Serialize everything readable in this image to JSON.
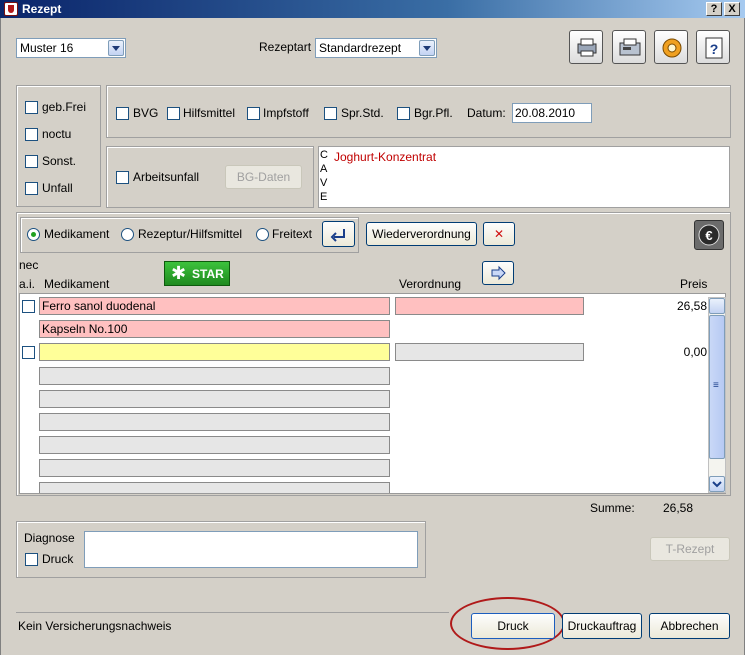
{
  "window": {
    "title": "Rezept",
    "help_btn": "?",
    "close_btn": "X"
  },
  "header": {
    "form_select": "Muster 16",
    "rezeptart_label": "Rezeptart",
    "rezeptart_select": "Standardrezept",
    "toolbar_icons": [
      "printer-icon",
      "card-reader-icon",
      "settings-icon",
      "help-book-icon"
    ]
  },
  "left_flags": [
    {
      "label": "geb.Frei",
      "checked": false
    },
    {
      "label": "noctu",
      "checked": false
    },
    {
      "label": "Sonst.",
      "checked": false
    },
    {
      "label": "Unfall",
      "checked": false
    }
  ],
  "top_flags": {
    "bvg": "BVG",
    "hilfsmittel": "Hilfsmittel",
    "impfstoff": "Impfstoff",
    "spr_std": "Spr.Std.",
    "bgr_pfl": "Bgr.Pfl.",
    "datum_label": "Datum:",
    "datum_value": "20.08.2010"
  },
  "arbeitsunfall": {
    "label": "Arbeitsunfall",
    "bg_button": "BG-Daten"
  },
  "cave": {
    "letters": [
      "C",
      "A",
      "V",
      "E"
    ],
    "text": "Joghurt-Konzentrat"
  },
  "mode": {
    "medikament": "Medikament",
    "rezeptur": "Rezeptur/Hilfsmittel",
    "freitext": "Freitext",
    "selected": "Medikament",
    "wiederverordnung": "Wiederverordnung"
  },
  "table": {
    "nec_label": "nec",
    "ai_label": "a.i.",
    "col_medikament": "Medikament",
    "col_verordnung": "Verordnung",
    "col_preis": "Preis",
    "star_label": "STAR",
    "rows": {
      "r1_med": "Ferro sanol duodenal",
      "r1_price": "26,58",
      "r1b_med": "Kapseln No.100",
      "r2_med": "",
      "r2_price": "0,00"
    },
    "summe_label": "Summe:",
    "summe_value": "26,58"
  },
  "diagnose": {
    "label": "Diagnose",
    "druck_label": "Druck",
    "t_rezept": "T-Rezept"
  },
  "footer": {
    "status": "Kein Versicherungsnachweis",
    "druck": "Druck",
    "druckauftrag": "Druckauftrag",
    "abbrechen": "Abbrechen"
  },
  "colors": {
    "pink": "#ffc0c0",
    "yellow": "#ffff99",
    "cave_text": "#c00000",
    "highlight": "#b01a1a"
  }
}
